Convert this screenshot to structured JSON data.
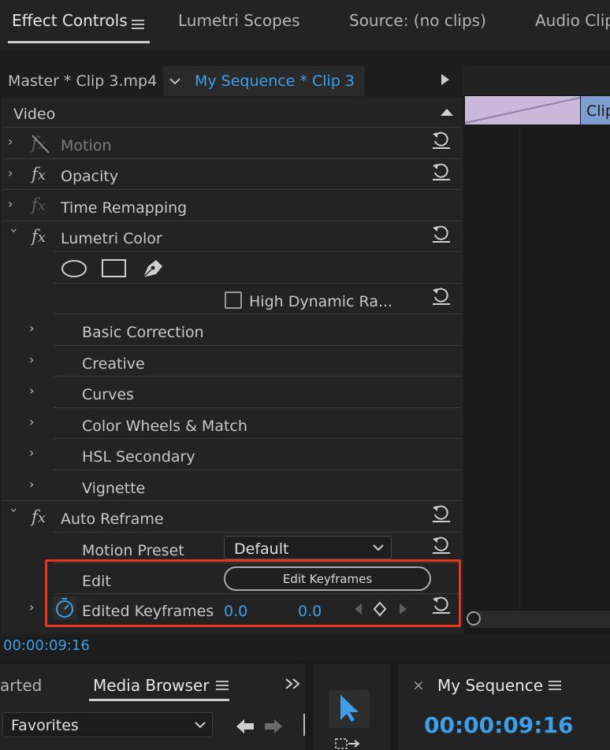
{
  "tabs": {
    "effect_controls": "Effect Controls",
    "lumetri_scopes": "Lumetri Scopes",
    "source": "Source: (no clips)",
    "audio_clip": "Audio Clip"
  },
  "source_bar": {
    "master": "Master * Clip 3.mp4",
    "sequence": "My Sequence * Clip 3"
  },
  "timeline_clip_label": "Clip",
  "video_header": "Video",
  "effects": {
    "motion": "Motion",
    "opacity": "Opacity",
    "time_remapping": "Time Remapping",
    "lumetri_color": "Lumetri Color",
    "hdr": "High Dynamic Ra...",
    "auto_reframe": "Auto Reframe"
  },
  "lumetri_sections": [
    "Basic Correction",
    "Creative",
    "Curves",
    "Color Wheels & Match",
    "HSL Secondary",
    "Vignette"
  ],
  "auto_reframe": {
    "motion_preset_label": "Motion Preset",
    "motion_preset_value": "Default",
    "edit_label": "Edit",
    "edit_button": "Edit Keyframes",
    "edited_kf_label": "Edited Keyframes",
    "kf_value_1": "0.0",
    "kf_value_2": "0.0"
  },
  "timecode_panel": "00:00:09:16",
  "bottom": {
    "started_partial": "arted",
    "media_browser": "Media Browser",
    "favorites": "Favorites",
    "close_symbol": "×",
    "sequence_name": "My Sequence",
    "sequence_timecode": "00:00:09:16"
  },
  "colors": {
    "accent_blue": "#3e9ee8",
    "highlight_red": "#e8361c"
  }
}
